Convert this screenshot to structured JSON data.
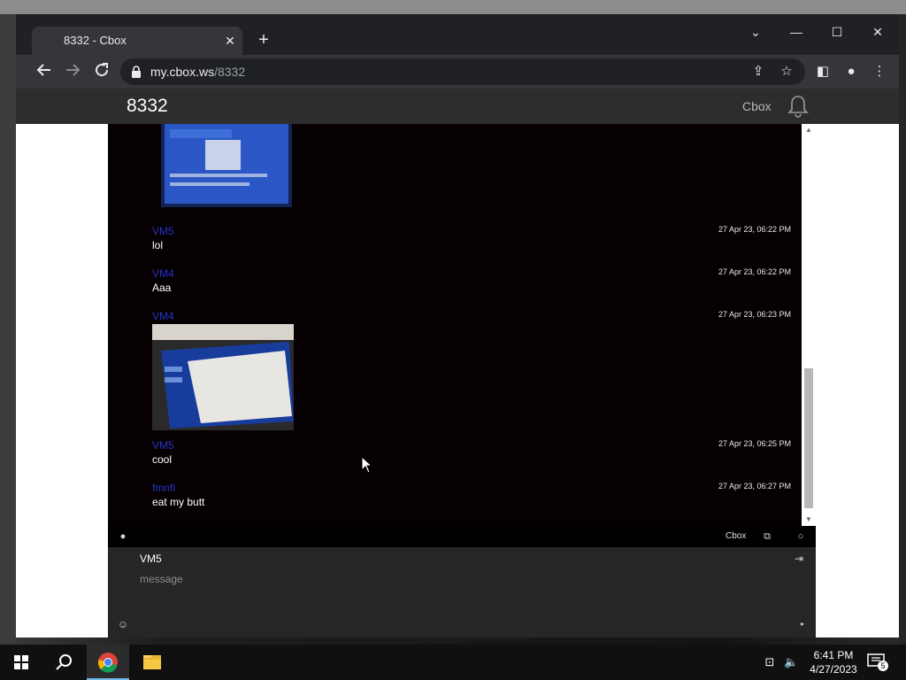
{
  "browser": {
    "tab_title": "8332 - Cbox",
    "url_host": "my.cbox.ws",
    "url_path": "/8332"
  },
  "site": {
    "title": "8332",
    "brand": "Cbox"
  },
  "messages": [
    {
      "name": "VM5",
      "time": "27 Apr 23, 06:22 PM",
      "text": "lol"
    },
    {
      "name": "VM4",
      "time": "27 Apr 23, 06:22 PM",
      "text": "Aaa"
    },
    {
      "name": "VM4",
      "time": "27 Apr 23, 06:23 PM",
      "text": ""
    },
    {
      "name": "VM5",
      "time": "27 Apr 23, 06:25 PM",
      "text": "cool"
    },
    {
      "name": "fmnfi",
      "time": "27 Apr 23, 06:27 PM",
      "text": "eat my butt"
    }
  ],
  "infobar": {
    "brand": "Cbox"
  },
  "composer": {
    "name": "VM5",
    "message_placeholder": "message"
  },
  "taskbar": {
    "time": "6:41 PM",
    "date": "4/27/2023",
    "notification_count": "5"
  },
  "icons": {
    "back": "arrow-left-icon",
    "forward": "arrow-right-icon",
    "reload": "reload-icon",
    "lock": "lock-icon",
    "share": "share-icon",
    "bookmark": "star-icon",
    "sidepanel": "side-panel-icon",
    "profile": "profile-icon",
    "menu": "kebab-menu-icon",
    "bell": "bell-icon"
  },
  "colors": {
    "chat_bg": "#060002",
    "username": "#2533c9",
    "header_bg": "#2d2d2d",
    "taskbar_bg": "#101010"
  }
}
